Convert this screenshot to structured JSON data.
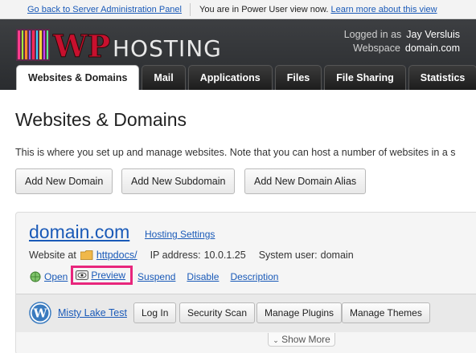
{
  "topbar": {
    "back_link": "Go back to Server Administration Panel",
    "mode_text": "You are in Power User view now.",
    "learn_link": "Learn more about this view"
  },
  "header": {
    "logo_text": "WP HOSTING",
    "logged_label": "Logged in as",
    "user": "Jay Versluis",
    "webspace_label": "Webspace",
    "webspace": "domain.com"
  },
  "tabs": [
    {
      "label": "Websites & Domains",
      "active": true
    },
    {
      "label": "Mail"
    },
    {
      "label": "Applications"
    },
    {
      "label": "Files"
    },
    {
      "label": "File Sharing"
    },
    {
      "label": "Statistics"
    },
    {
      "label": ""
    }
  ],
  "main": {
    "title": "Websites & Domains",
    "description": "This is where you set up and manage websites. Note that you can host a number of websites in a s",
    "buttons": {
      "add_domain": "Add New Domain",
      "add_subdomain": "Add New Subdomain",
      "add_alias": "Add New Domain Alias"
    }
  },
  "domain": {
    "name": "domain.com",
    "hosting_settings": "Hosting Settings",
    "website_at": "Website at",
    "docroot": "httpdocs/",
    "ip_label": "IP address:",
    "ip": "10.0.1.25",
    "sysuser_label": "System user:",
    "sysuser": "domain",
    "actions": {
      "open": "Open",
      "preview": "Preview",
      "suspend": "Suspend",
      "disable": "Disable",
      "description": "Description"
    },
    "highlight_color": "#e8267c"
  },
  "wordpress": {
    "site_name": "Misty Lake Test",
    "login": "Log In",
    "security": "Security Scan",
    "plugins": "Manage Plugins",
    "themes": "Manage Themes",
    "show_more": "Show More"
  }
}
